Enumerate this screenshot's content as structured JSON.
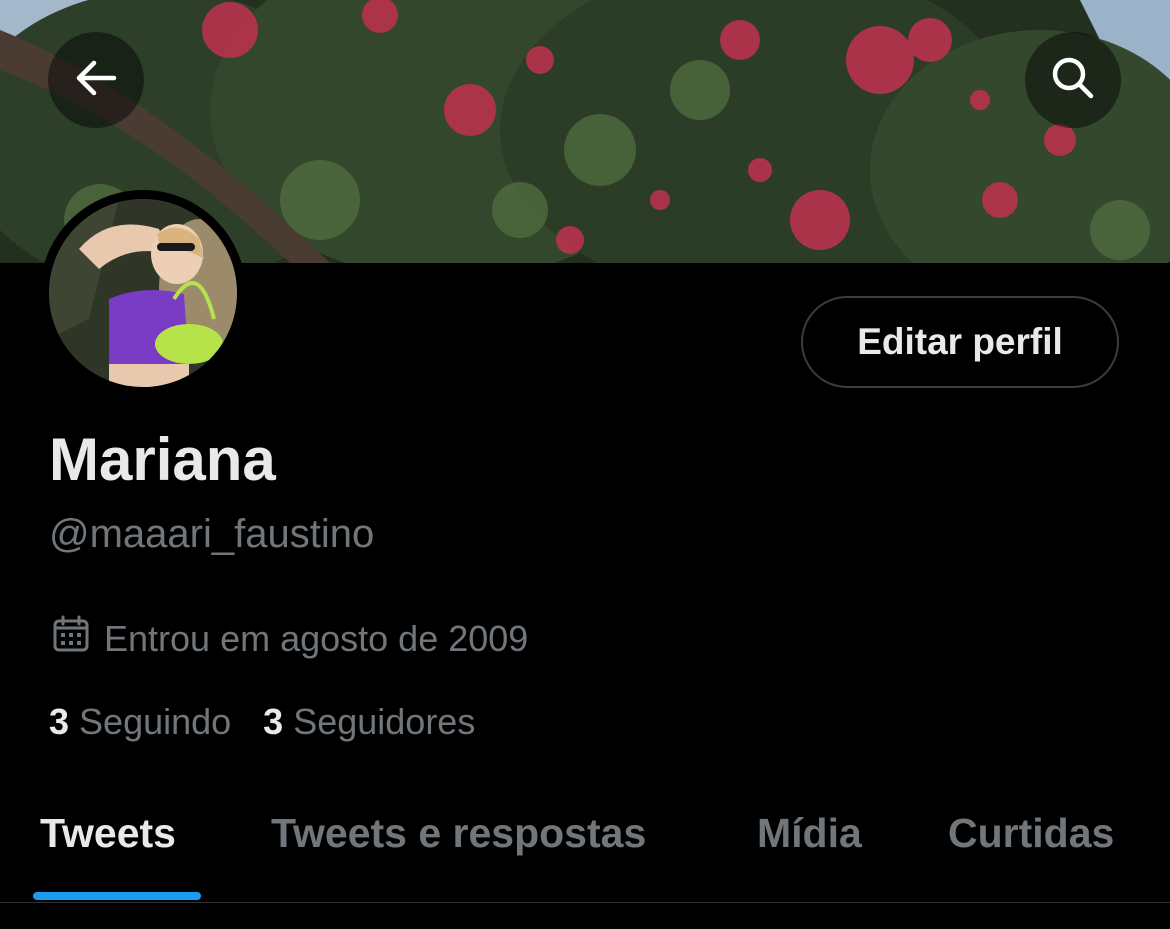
{
  "profile": {
    "name": "Mariana",
    "handle": "@maaari_faustino",
    "joined": "Entrou em agosto de 2009",
    "following_count": "3",
    "following_label": "Seguindo",
    "followers_count": "3",
    "followers_label": "Seguidores"
  },
  "actions": {
    "edit_profile": "Editar perfil"
  },
  "tabs": [
    {
      "label": "Tweets",
      "active": true
    },
    {
      "label": "Tweets e respostas",
      "active": false
    },
    {
      "label": "Mídia",
      "active": false
    },
    {
      "label": "Curtidas",
      "active": false
    }
  ],
  "icons": {
    "back": "arrow-left-icon",
    "search": "search-icon",
    "calendar": "calendar-icon"
  },
  "colors": {
    "accent": "#1d9bf0",
    "background": "#000000",
    "primary_text": "#e7e9ea",
    "secondary_text": "#71767b"
  }
}
